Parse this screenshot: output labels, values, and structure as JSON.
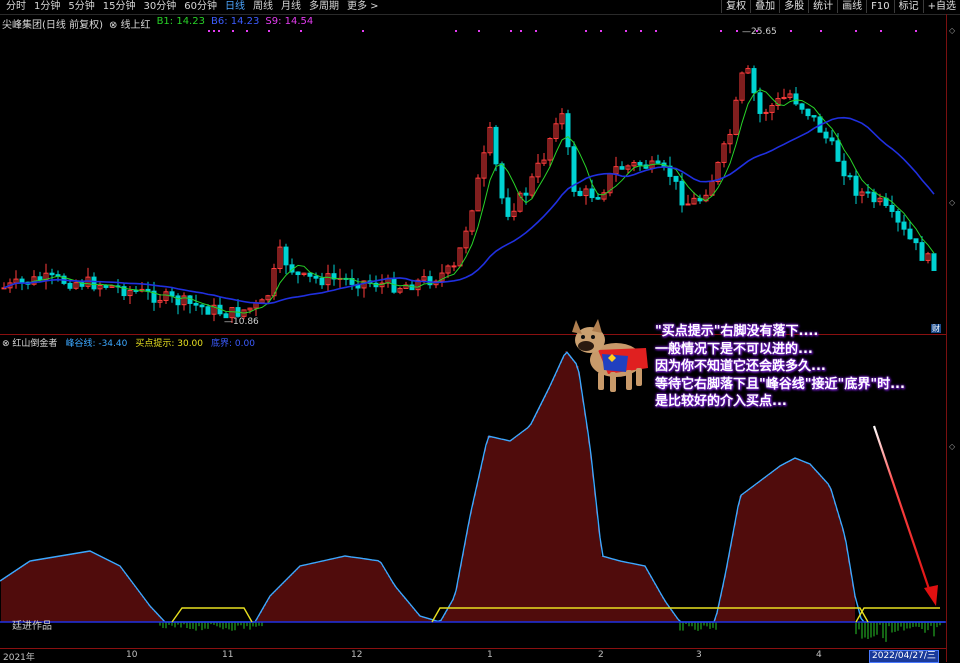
{
  "toolbar": {
    "periods": [
      "分时",
      "1分钟",
      "5分钟",
      "15分钟",
      "30分钟",
      "60分钟",
      "日线",
      "周线",
      "月线",
      "多周期",
      "更多 >"
    ],
    "active_period": "日线",
    "right_buttons": [
      "复权",
      "叠加",
      "多股",
      "统计",
      "画线",
      "F10",
      "标记",
      "+自选"
    ]
  },
  "main_chart": {
    "stock_name": "尖峰集团(日线 前复权)",
    "indicator_name": "线上红",
    "b1": "B1: 14.23",
    "b6": "B6: 14.23",
    "s9": "S9: 14.54",
    "high_label": "25.65",
    "low_label": "10.86",
    "badge": "财"
  },
  "sub_chart": {
    "name": "红山倒金者",
    "peak_line": "峰谷线: -34.40",
    "buy_hint": "买点提示: 30.00",
    "base_line": "底界: 0.00",
    "watermark": "廷进作品"
  },
  "note": {
    "lines": [
      "\"买点提示\"右脚没有落下....",
      "一般情况下是不可以进的...",
      "因为你不知道它还会跌多久...",
      "等待它右脚落下且\"峰谷线\"接近\"底界\"时...",
      "是比较好的介入买点..."
    ]
  },
  "time_axis": {
    "labels": [
      {
        "text": "2021年"
      },
      {
        "text": "10"
      },
      {
        "text": "11"
      },
      {
        "text": "12"
      },
      {
        "text": "1"
      },
      {
        "text": "2"
      },
      {
        "text": "3"
      },
      {
        "text": "4"
      }
    ],
    "current_date": "2022/04/27/三"
  },
  "colors": {
    "up": "#ff3c3c",
    "down": "#00d2d2",
    "ma_short": "#28d228",
    "ma_long": "#2030e0",
    "peak_line": "#3ca8ff",
    "buy_hint": "#e8e020",
    "bars": "#a01818",
    "note_glow": "#7b1fd6"
  },
  "icons": [
    "close-icon",
    "arrow-icon"
  ]
}
